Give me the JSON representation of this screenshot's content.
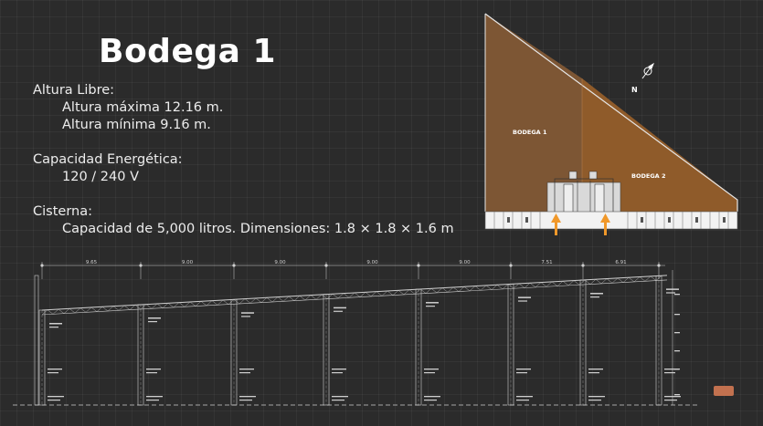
{
  "header": {
    "title": "Bodega 1"
  },
  "altura": {
    "heading": "Altura Libre:",
    "maxima": "Altura máxima 12.16 m.",
    "minima": "Altura mínima 9.16 m."
  },
  "capacidad": {
    "heading": "Capacidad Energética:",
    "value": "120 / 240 V"
  },
  "cisterna": {
    "heading": "Cisterna:",
    "value": "Capacidad de 5,000 litros. Dimensiones: 1.8 × 1.8 × 1.6 m"
  },
  "plan": {
    "bodega1_label": "BODEGA 1",
    "bodega2_label": "BODEGA 2",
    "north_label": "N",
    "color_bodega1": "#7d5634",
    "color_bodega2": "#8f5b2a",
    "arrow_color": "#f0982a"
  },
  "section": {
    "dimensions": [
      "9.65",
      "9.00",
      "9.00",
      "9.00",
      "9.00",
      "7.51",
      "6.91"
    ],
    "line_color": "#cfcfcf"
  }
}
